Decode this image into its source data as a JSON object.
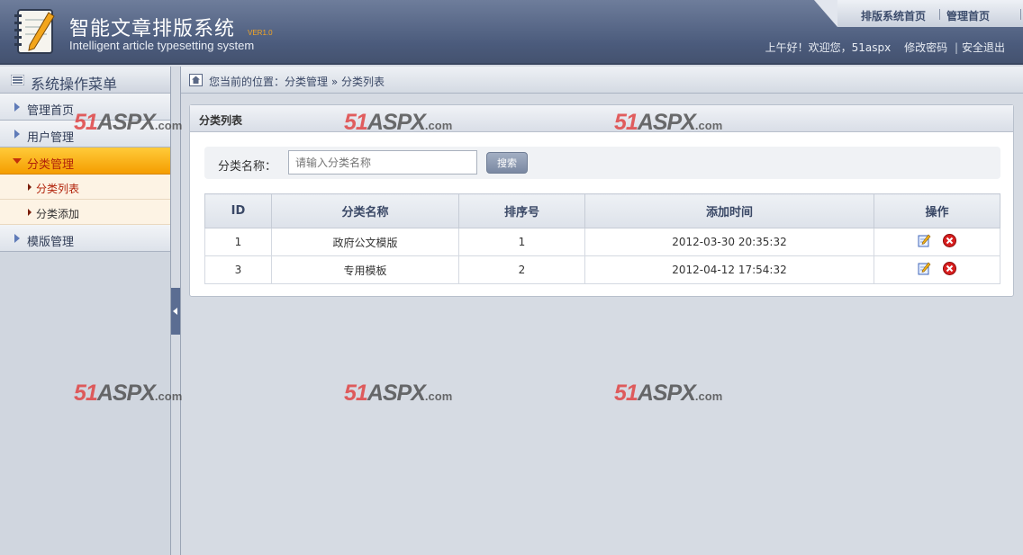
{
  "header": {
    "title_cn": "智能文章排版系统",
    "version": "VER1.0",
    "title_en": "Intelligent article typesetting system",
    "tabs": [
      {
        "label": "排版系统首页"
      },
      {
        "label": "管理首页"
      }
    ],
    "user_bar": {
      "greeting": "上午好！欢迎您，51aspx",
      "change_password": "修改密码",
      "separator": "|",
      "logout": "安全退出"
    }
  },
  "sidebar": {
    "title": "系统操作菜单",
    "items": [
      {
        "label": "管理首页"
      },
      {
        "label": "用户管理"
      },
      {
        "label": "分类管理"
      },
      {
        "label": "模版管理"
      }
    ],
    "sub_items": [
      {
        "label": "分类列表"
      },
      {
        "label": "分类添加"
      }
    ]
  },
  "breadcrumb": {
    "text": "您当前的位置：分类管理 » 分类列表"
  },
  "panel": {
    "title": "分类列表",
    "search": {
      "label": "分类名称：",
      "placeholder": "请输入分类名称",
      "value": "",
      "button": "搜索"
    },
    "table": {
      "columns": [
        "ID",
        "分类名称",
        "排序号",
        "添加时间",
        "操作"
      ],
      "rows": [
        {
          "id": "1",
          "name": "政府公文模版",
          "order": "1",
          "time": "2012-03-30 20:35:32"
        },
        {
          "id": "3",
          "name": "专用模板",
          "order": "2",
          "time": "2012-04-12 17:54:32"
        }
      ]
    }
  },
  "watermark": {
    "num": "51",
    "mid": "ASPX",
    "suffix": ".com"
  },
  "colors": {
    "header_bg": "#4b5b7c",
    "active_menu": "#f59d00",
    "active_text": "#b1220a"
  }
}
